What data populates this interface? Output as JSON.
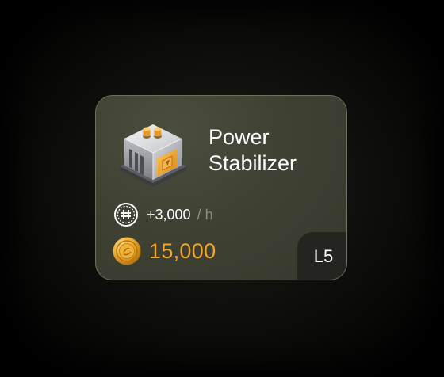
{
  "card": {
    "title": "Power Stabilizer",
    "rate": {
      "value": "+3,000",
      "unit": "/ h",
      "icon": "hashrate-icon"
    },
    "price": {
      "value": "15,000",
      "icon": "coin-icon"
    },
    "level": "L5",
    "item_icon": "power-stabilizer-icon"
  },
  "colors": {
    "card_background": "#3f4233",
    "card_border": "#6d7058",
    "price": "#f2a52a",
    "rate_unit": "#8d8f80",
    "level_badge": "#242420"
  }
}
